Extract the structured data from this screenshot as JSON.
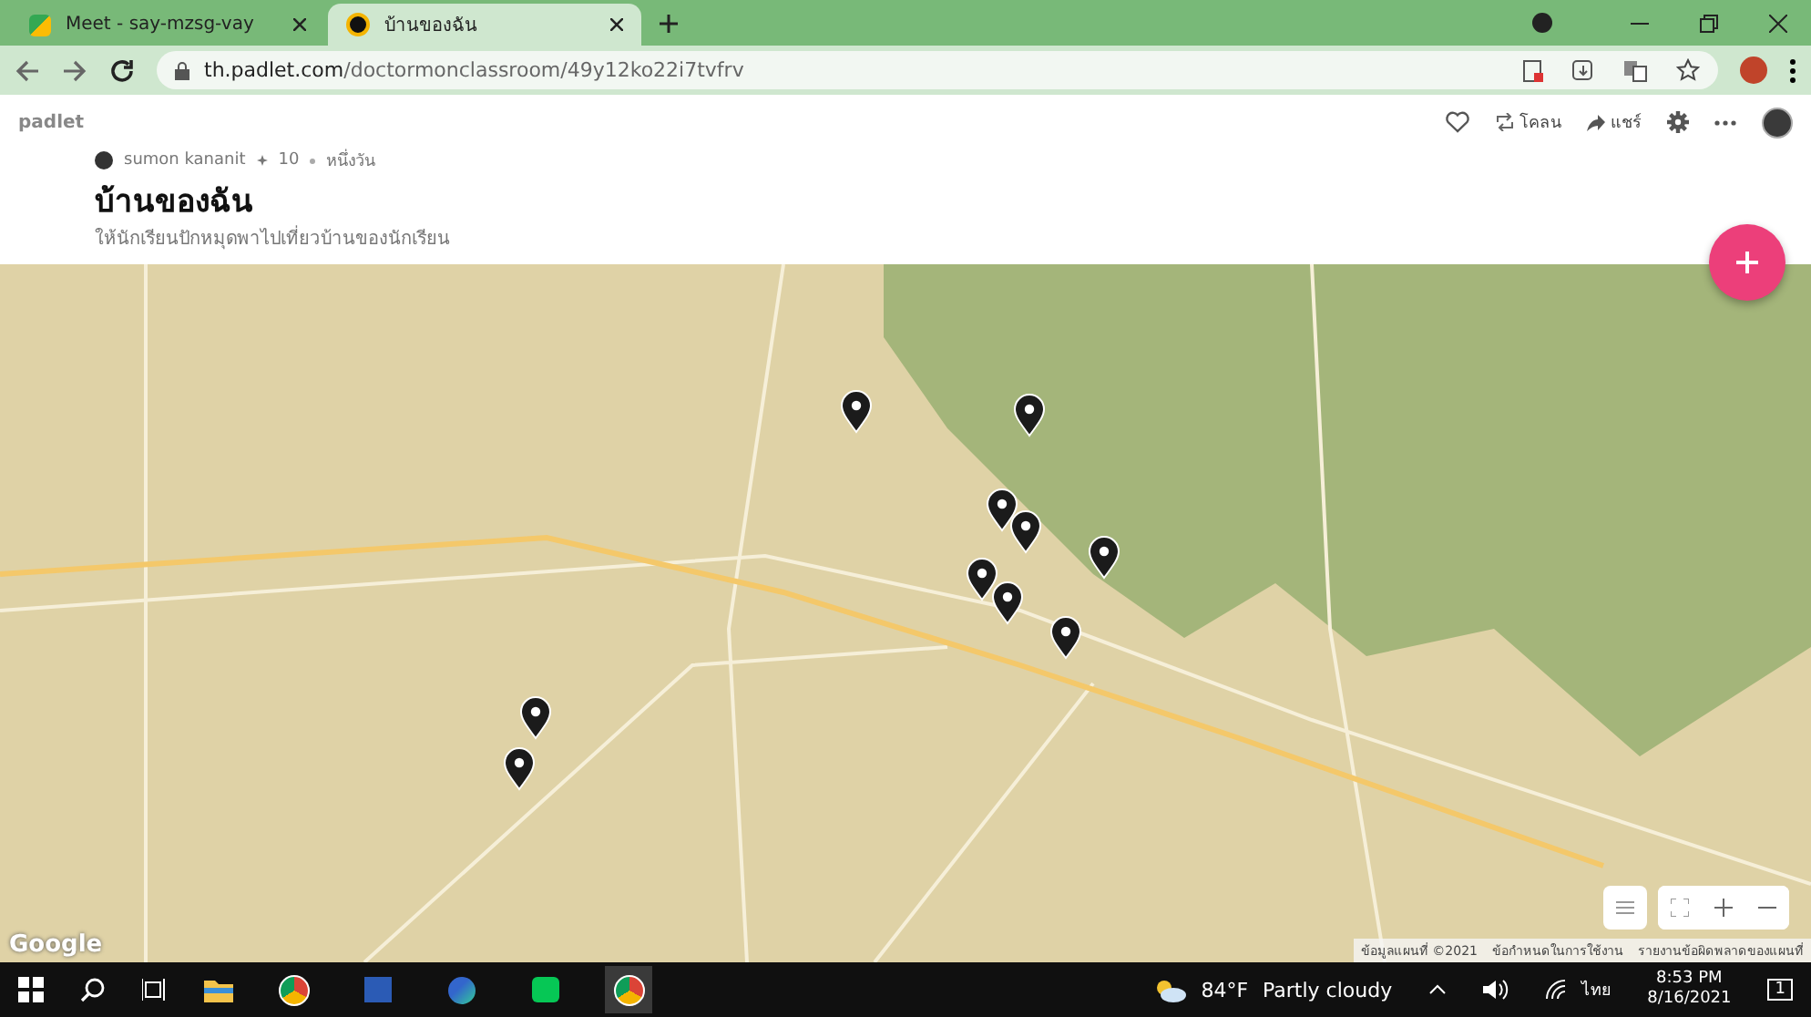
{
  "browser": {
    "tabs": [
      {
        "title": "Meet - say-mzsg-vay",
        "selected": false
      },
      {
        "title": "บ้านของฉัน",
        "selected": true
      }
    ],
    "url": {
      "host": "th.padlet.com",
      "path": "/doctormonclassroom/49y12ko22i7tvfrv"
    }
  },
  "padlet": {
    "logo": "padlet",
    "author": "sumon kananit",
    "likes": "10",
    "time": "หนึ่งวัน",
    "title": "บ้านของฉัน",
    "description": "ให้นักเรียนปักหมุดพาไปเที่ยวบ้านของนักเรียน",
    "actions": [
      {
        "kind": "clone",
        "label": "โคลน"
      },
      {
        "kind": "share",
        "label": "แชร์"
      }
    ]
  },
  "map": {
    "logo": "Google",
    "attribution": [
      "ข้อมูลแผนที่ ©2021",
      "ข้อกำหนดในการใช้งาน",
      "รายงานข้อผิดพลาดของแผนที่"
    ]
  },
  "taskbar": {
    "temperature": "84°F",
    "weather": "Partly cloudy",
    "language": "ไทย",
    "time": "8:53 PM",
    "date": "8/16/2021",
    "notifications": "1"
  }
}
